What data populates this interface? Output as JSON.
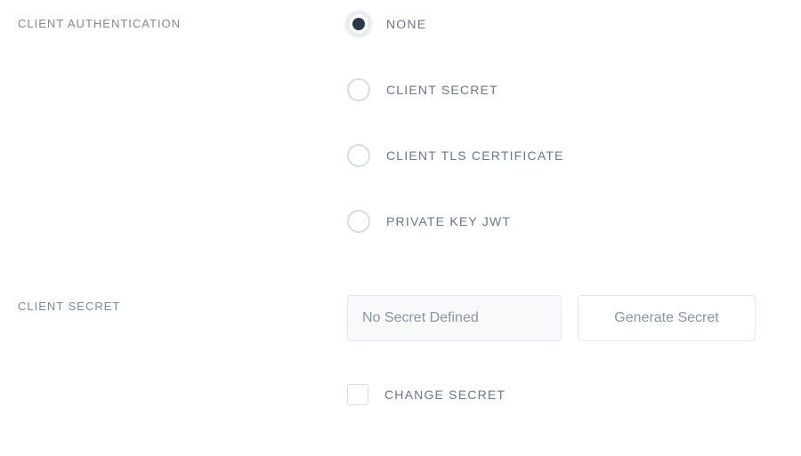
{
  "auth": {
    "label": "Client Authentication",
    "options": {
      "none": "None",
      "client_secret": "Client Secret",
      "client_tls": "Client TLS Certificate",
      "private_key_jwt": "Private Key JWT"
    },
    "selected": "none"
  },
  "secret": {
    "label": "Client Secret",
    "placeholder": "No Secret Defined",
    "generate_label": "Generate Secret",
    "change_label": "Change Secret"
  }
}
